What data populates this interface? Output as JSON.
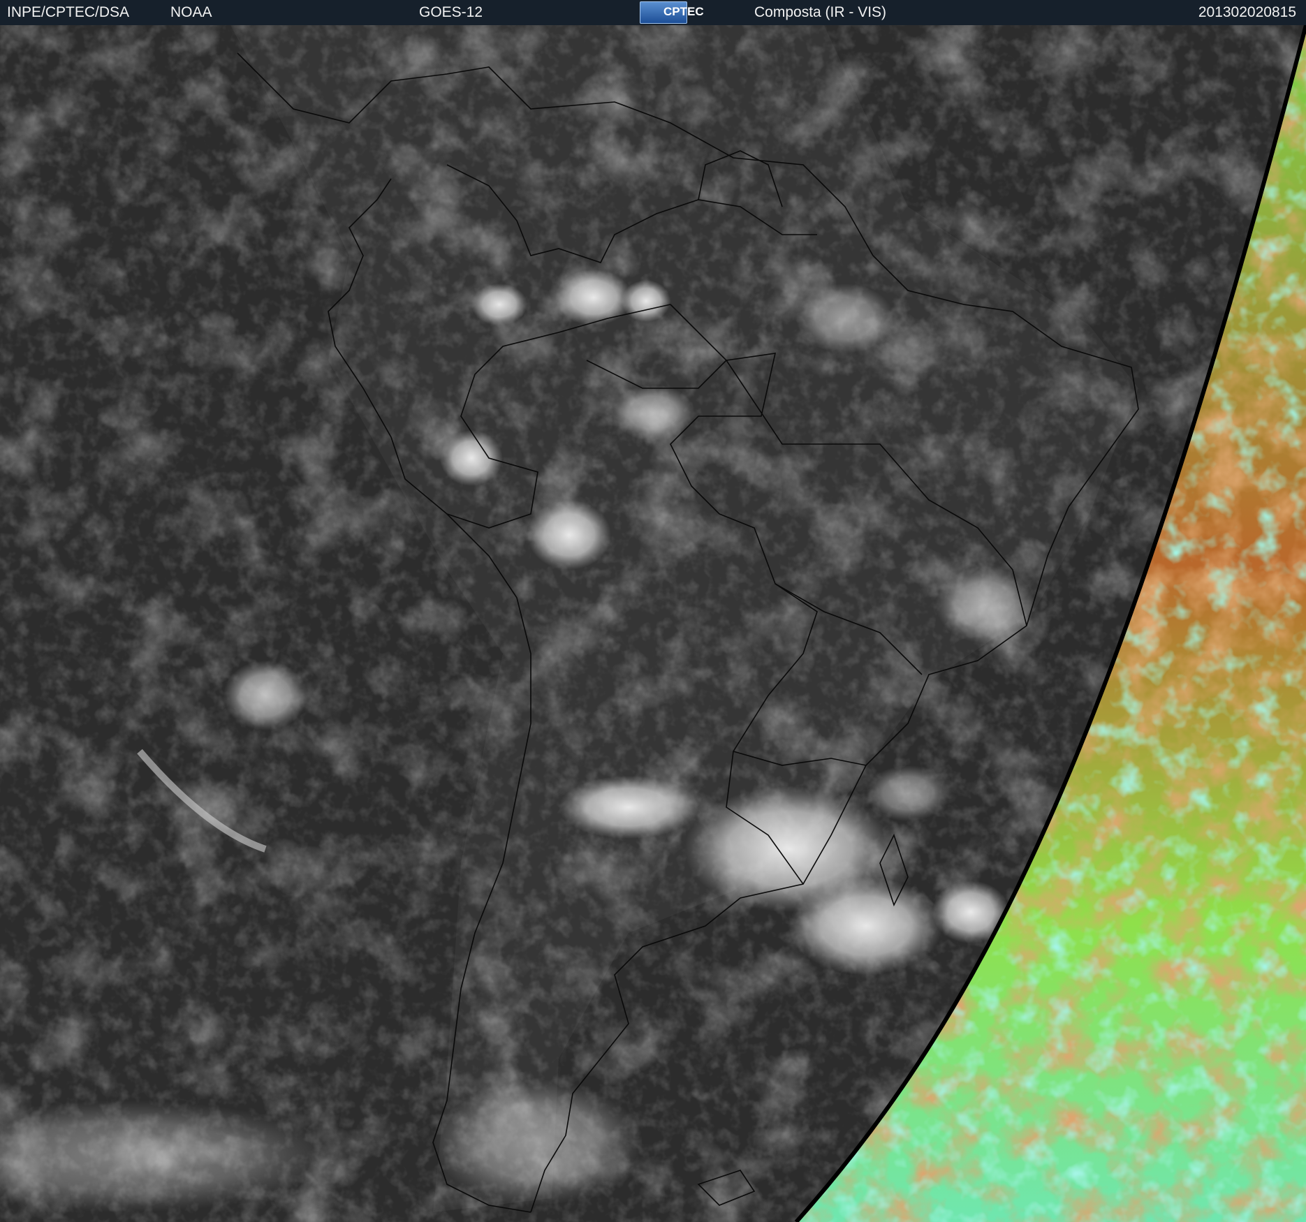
{
  "header": {
    "organization": "INPE/CPTEC/DSA",
    "agency": "NOAA",
    "satellite": "GOES-12",
    "logo_text": "CPTEC",
    "product": "Composta (IR - VIS)",
    "timestamp": "201302020815"
  },
  "imagery": {
    "scene": "South America composite satellite image, grayscale infrared over night side and false-color visible over day side",
    "colors": {
      "ocean_dark": "#2a2a2a",
      "cloud_white": "#e6e6e6",
      "vis_orange": "#b8642a",
      "vis_green": "#86e34a",
      "vis_cyan": "#5fe8c8",
      "boundary": "#0a0a0a"
    }
  }
}
